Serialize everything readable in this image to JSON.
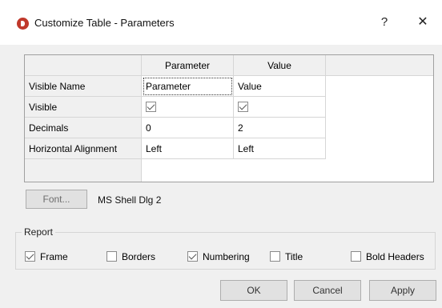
{
  "window": {
    "title": "Customize Table - Parameters",
    "help_label": "?",
    "close_label": "✕"
  },
  "grid": {
    "columns": [
      "Parameter",
      "Value"
    ],
    "rows": [
      {
        "label": "Visible Name",
        "parameter": "Parameter",
        "value": "Value"
      },
      {
        "label": "Visible",
        "parameter_checked": true,
        "value_checked": true
      },
      {
        "label": "Decimals",
        "parameter": "0",
        "value": "2"
      },
      {
        "label": "Horizontal Alignment",
        "parameter": "Left",
        "value": "Left"
      }
    ]
  },
  "font": {
    "button_label": "Font...",
    "current": "MS Shell Dlg 2"
  },
  "report": {
    "legend": "Report",
    "options": [
      {
        "label": "Frame",
        "checked": true
      },
      {
        "label": "Borders",
        "checked": false
      },
      {
        "label": "Numbering",
        "checked": true
      },
      {
        "label": "Title",
        "checked": false
      },
      {
        "label": "Bold Headers",
        "checked": false
      }
    ]
  },
  "buttons": {
    "ok": "OK",
    "cancel": "Cancel",
    "apply": "Apply"
  },
  "colors": {
    "dialog_bg": "#f0f0f0",
    "grid_border": "#a0a0a0",
    "app_icon": "#c0392b"
  }
}
